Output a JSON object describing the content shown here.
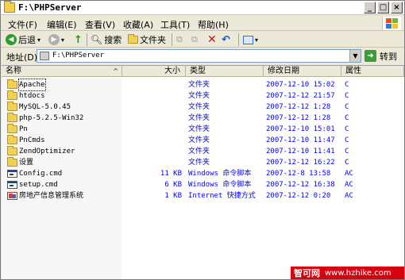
{
  "window": {
    "title": "F:\\PHPServer"
  },
  "menu": [
    "文件(F)",
    "编辑(E)",
    "查看(V)",
    "收藏(A)",
    "工具(T)",
    "帮助(H)"
  ],
  "toolbar": {
    "back": "后退",
    "search": "搜索",
    "folders": "文件夹"
  },
  "address": {
    "label": "地址(D)",
    "value": "F:\\PHPServer",
    "go": "转到"
  },
  "columns": {
    "name": "名称",
    "size": "大小",
    "type": "类型",
    "modified": "修改日期",
    "attr": "属性"
  },
  "files": [
    {
      "name": "Apache",
      "size": "",
      "type": "文件夹",
      "modified": "2007-12-10 15:02",
      "attr": "C",
      "icon": "folder"
    },
    {
      "name": "htdocs",
      "size": "",
      "type": "文件夹",
      "modified": "2007-12-12 21:57",
      "attr": "C",
      "icon": "folder"
    },
    {
      "name": "MySQL-5.0.45",
      "size": "",
      "type": "文件夹",
      "modified": "2007-12-12 1:28",
      "attr": "C",
      "icon": "folder"
    },
    {
      "name": "php-5.2.5-Win32",
      "size": "",
      "type": "文件夹",
      "modified": "2007-12-12 1:28",
      "attr": "C",
      "icon": "folder"
    },
    {
      "name": "Pn",
      "size": "",
      "type": "文件夹",
      "modified": "2007-12-10 15:01",
      "attr": "C",
      "icon": "folder"
    },
    {
      "name": "PnCmds",
      "size": "",
      "type": "文件夹",
      "modified": "2007-12-10 11:47",
      "attr": "C",
      "icon": "folder"
    },
    {
      "name": "ZendOptimizer",
      "size": "",
      "type": "文件夹",
      "modified": "2007-12-10 11:41",
      "attr": "C",
      "icon": "folder"
    },
    {
      "name": "设置",
      "size": "",
      "type": "文件夹",
      "modified": "2007-12-12 16:22",
      "attr": "C",
      "icon": "folder"
    },
    {
      "name": "Config.cmd",
      "size": "11 KB",
      "type": "Windows 命令脚本",
      "modified": "2007-12-8 13:58",
      "attr": "AC",
      "icon": "cmd"
    },
    {
      "name": "setup.cmd",
      "size": "6 KB",
      "type": "Windows 命令脚本",
      "modified": "2007-12-12 16:38",
      "attr": "AC",
      "icon": "cmd"
    },
    {
      "name": "房地产信息管理系统",
      "size": "1 KB",
      "type": "Internet 快捷方式",
      "modified": "2007-12-12 0:20",
      "attr": "AC",
      "icon": "internet-shortcut"
    }
  ],
  "watermark": {
    "brand": "智可网",
    "url": "www.hzhike.com"
  }
}
